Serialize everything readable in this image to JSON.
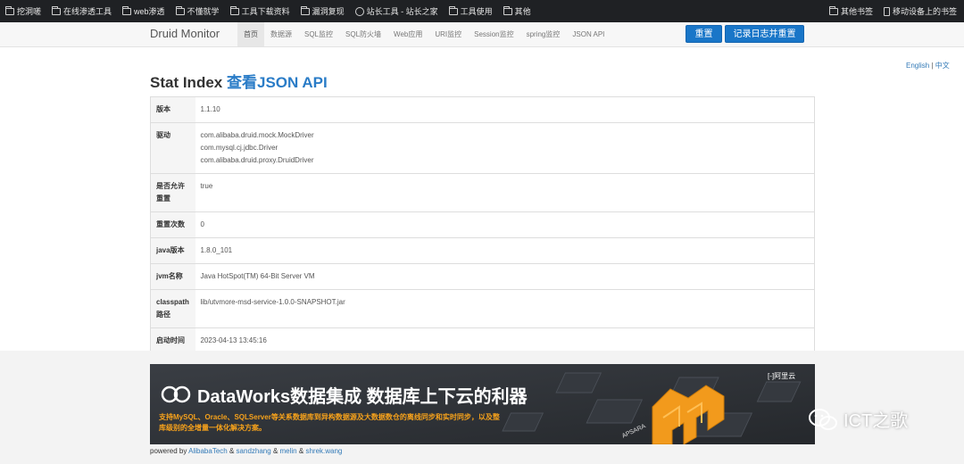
{
  "bookmarks": {
    "items": [
      {
        "label": "挖洞嗟",
        "icon": "folder-icon"
      },
      {
        "label": "在线渗透工具",
        "icon": "folder-icon"
      },
      {
        "label": "web渗透",
        "icon": "folder-icon"
      },
      {
        "label": "不懂就学",
        "icon": "folder-icon"
      },
      {
        "label": "工具下载资料",
        "icon": "folder-icon"
      },
      {
        "label": "漏洞复现",
        "icon": "folder-icon"
      },
      {
        "label": "站长工具 - 站长之家",
        "icon": "globe-icon"
      },
      {
        "label": "工具使用",
        "icon": "folder-icon"
      },
      {
        "label": "其他",
        "icon": "folder-icon"
      }
    ],
    "other": "其他书签",
    "mobile": "移动设备上的书签"
  },
  "navbar": {
    "brand": "Druid Monitor",
    "items": [
      "首页",
      "数据源",
      "SQL监控",
      "SQL防火墙",
      "Web应用",
      "URI监控",
      "Session监控",
      "spring监控",
      "JSON API"
    ],
    "reset_label": "重置",
    "log_reset_label": "记录日志并重置"
  },
  "lang": {
    "english": "English",
    "sep": "|",
    "chinese": "中文"
  },
  "page": {
    "title": "Stat Index",
    "json_link": "查看JSON API"
  },
  "stats": [
    {
      "key": "版本",
      "values": [
        "1.1.10"
      ]
    },
    {
      "key": "驱动",
      "values": [
        "com.alibaba.druid.mock.MockDriver",
        "com.mysql.cj.jdbc.Driver",
        "com.alibaba.druid.proxy.DruidDriver"
      ]
    },
    {
      "key": "是否允许重置",
      "values": [
        "true"
      ]
    },
    {
      "key": "重置次数",
      "values": [
        "0"
      ]
    },
    {
      "key": "java版本",
      "values": [
        "1.8.0_101"
      ]
    },
    {
      "key": "jvm名称",
      "values": [
        "Java HotSpot(TM) 64-Bit Server VM"
      ]
    },
    {
      "key": "classpath路径",
      "values": [
        "lib/utvmore-msd-service-1.0.0-SNAPSHOT.jar"
      ]
    },
    {
      "key": "启动时间",
      "values": [
        "2023-04-13 13:45:16"
      ]
    }
  ],
  "banner": {
    "title": "DataWorks数据集成 数据库上下云的利器",
    "line1": "支持MySQL、Oracle、SQLServer等关系数据库到异构数据源及大数据数仓的离线同步和实时同步，以及整",
    "line2": "库级别的全增量一体化解决方案。",
    "brand": "[-]阿里云",
    "apsara": "APSARA"
  },
  "watermark": "ICT之歌",
  "footer": {
    "prefix": "powered by",
    "links": [
      "AlibabaTech",
      "sandzhang",
      "melin",
      "shrek.wang"
    ],
    "sep": "&"
  },
  "colors": {
    "accent": "#1976c8",
    "link": "#2a7cc7",
    "banner_orange": "#f7a21b"
  }
}
